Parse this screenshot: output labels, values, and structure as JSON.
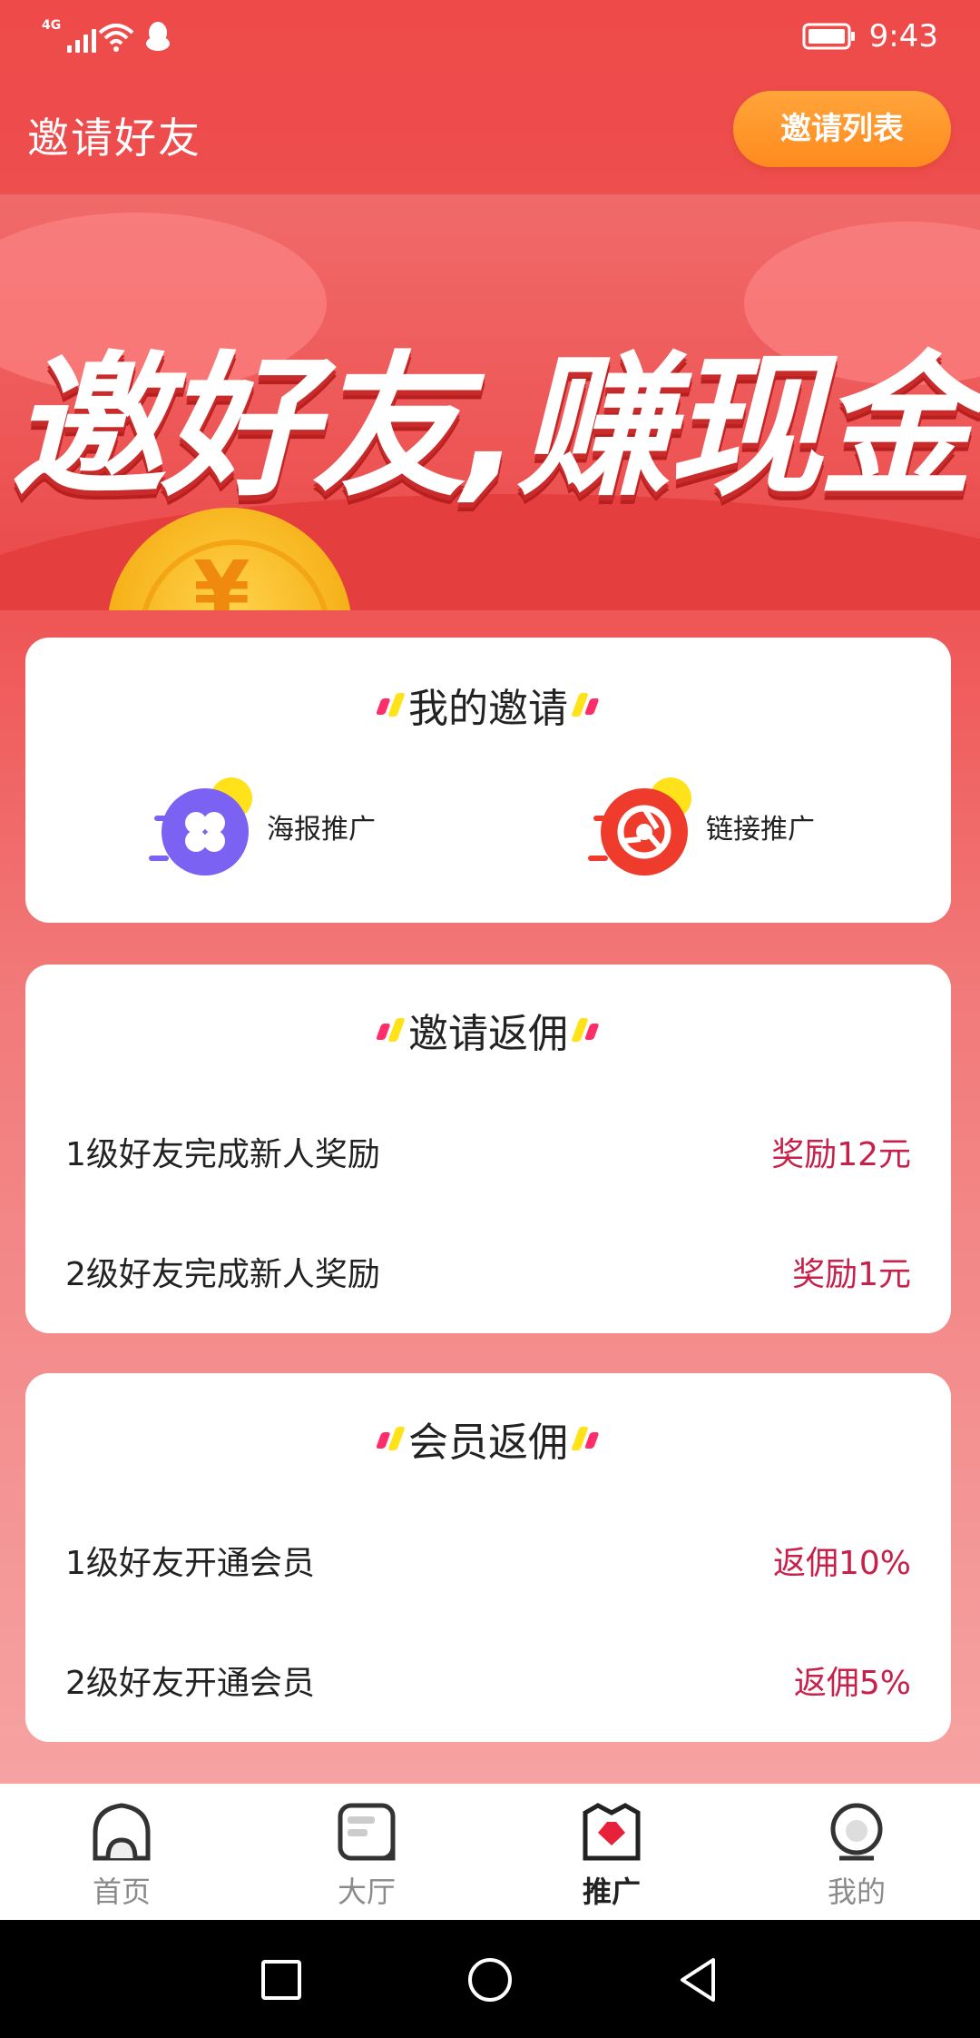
{
  "status_bar": {
    "network": "4G",
    "time": "9:43"
  },
  "header": {
    "title": "邀请好友",
    "invite_list_label": "邀请列表"
  },
  "banner": {
    "slogan": "邀好友,赚现金",
    "coin_mark": "¥"
  },
  "my_invite": {
    "title": "我的邀请",
    "items": [
      {
        "label": "海报推广",
        "icon": "clover-icon",
        "color": "#7b62f3"
      },
      {
        "label": "链接推广",
        "icon": "chrome-icon",
        "color": "#ee3b2c"
      }
    ]
  },
  "invite_rebate": {
    "title": "邀请返佣",
    "rows": [
      {
        "label": "1级好友完成新人奖励",
        "value": "奖励12元"
      },
      {
        "label": "2级好友完成新人奖励",
        "value": "奖励1元"
      }
    ]
  },
  "member_rebate": {
    "title": "会员返佣",
    "rows": [
      {
        "label": "1级好友开通会员",
        "value": "返佣10%"
      },
      {
        "label": "2级好友开通会员",
        "value": "返佣5%"
      }
    ]
  },
  "bottom_nav": {
    "active": "推广",
    "items": [
      {
        "label": "首页",
        "icon": "home-icon"
      },
      {
        "label": "大厅",
        "icon": "hall-icon"
      },
      {
        "label": "推广",
        "icon": "promote-icon"
      },
      {
        "label": "我的",
        "icon": "profile-icon"
      }
    ]
  },
  "colors": {
    "accent_red": "#ee4a4a",
    "button_orange": "#ff9a2e",
    "value_text": "#c7204a"
  }
}
